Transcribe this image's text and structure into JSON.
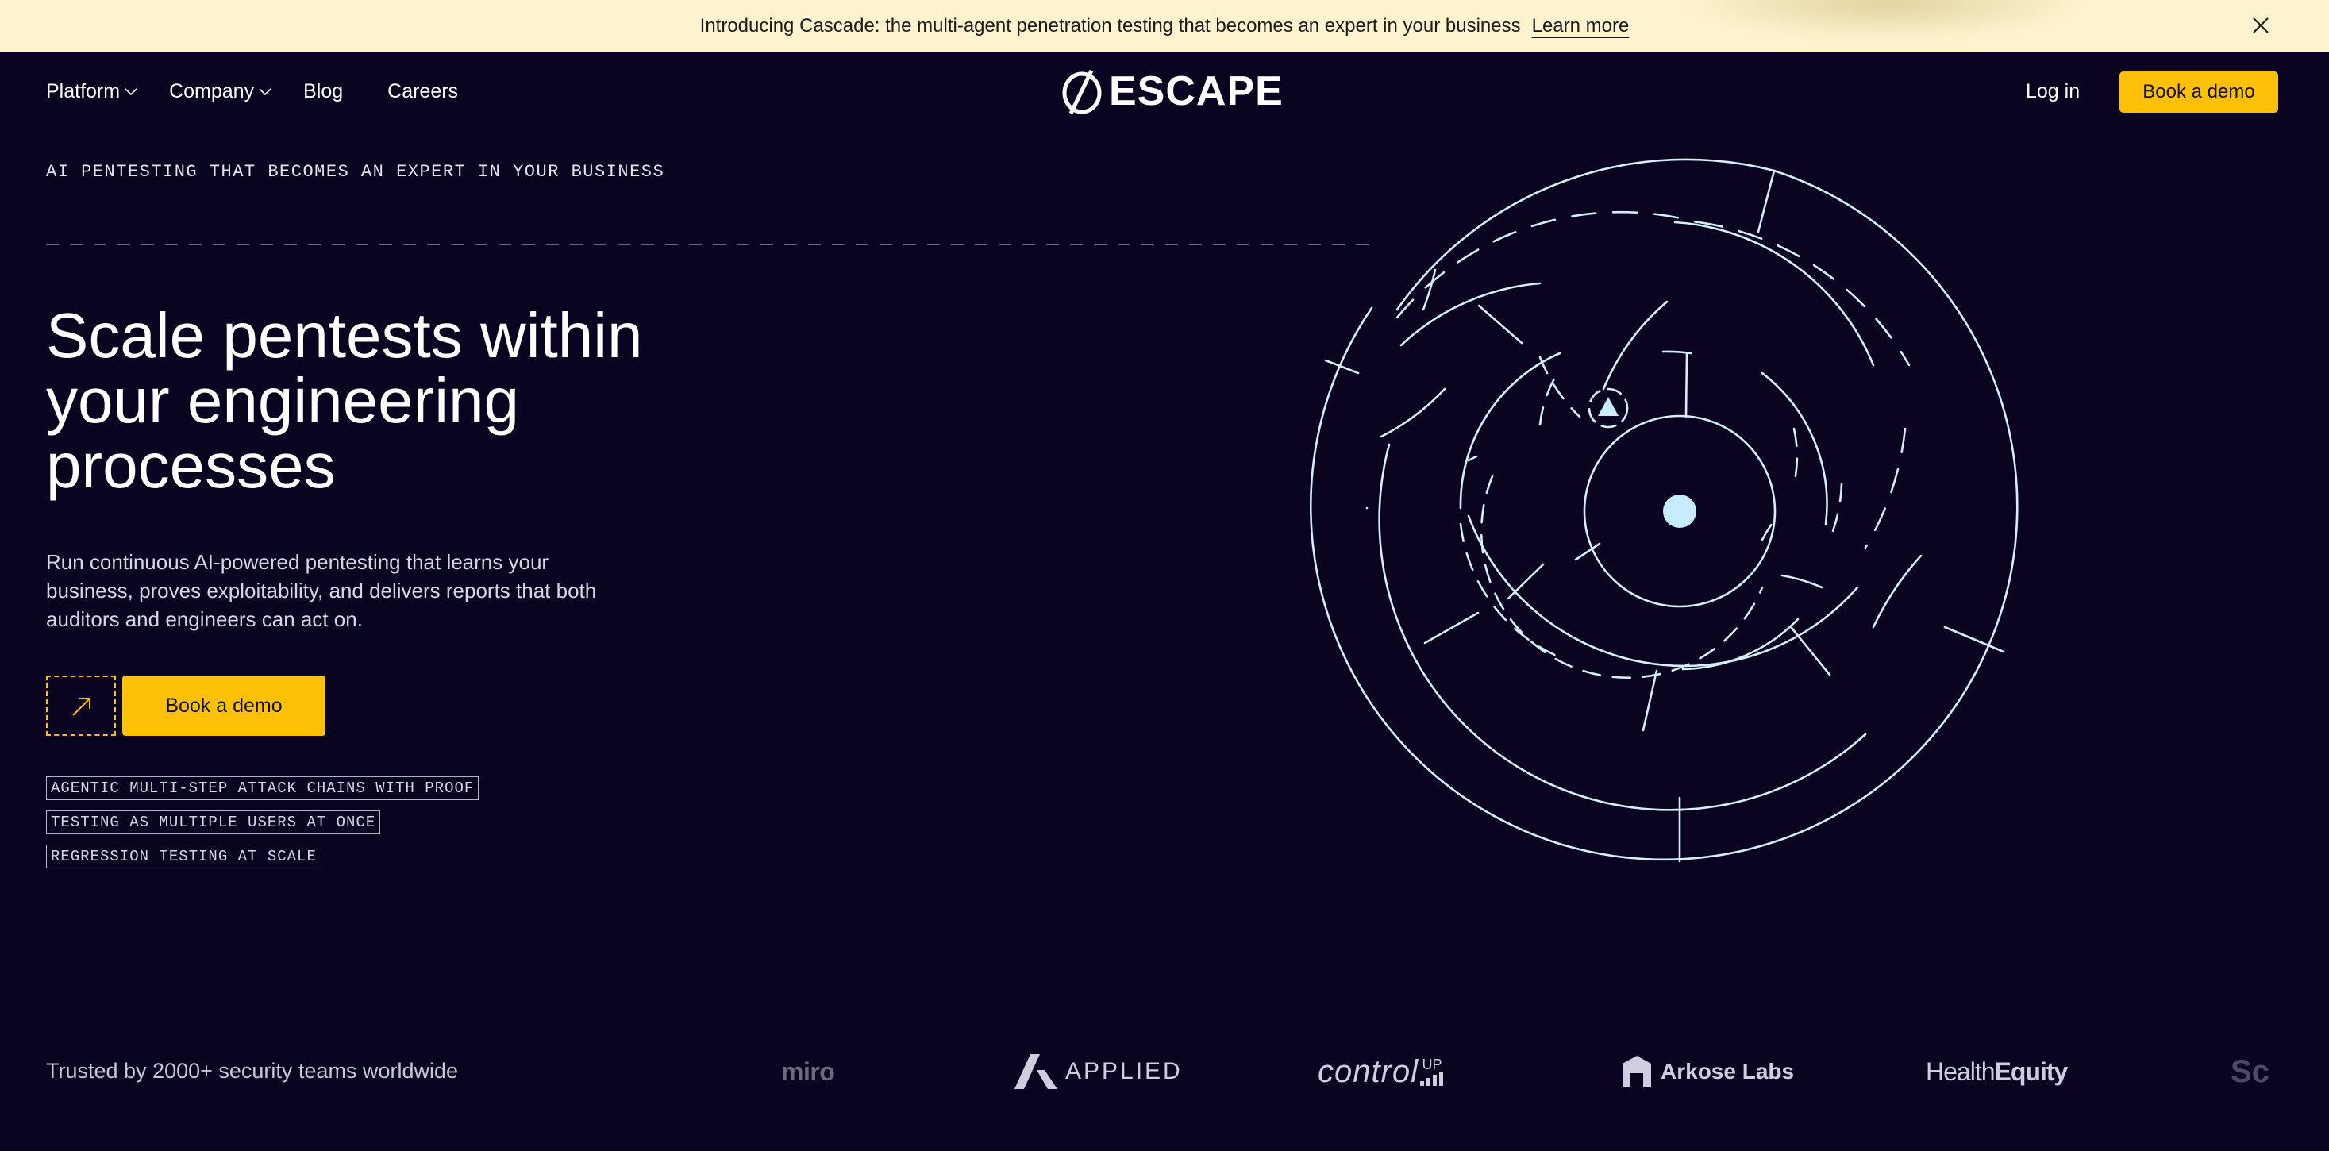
{
  "announcement": {
    "text": "Introducing Cascade: the multi-agent penetration testing that becomes an expert in your business",
    "link_label": "Learn more"
  },
  "nav": {
    "items": [
      {
        "label": "Platform",
        "has_dropdown": true
      },
      {
        "label": "Company",
        "has_dropdown": true
      },
      {
        "label": "Blog",
        "has_dropdown": false
      },
      {
        "label": "Careers",
        "has_dropdown": false
      }
    ],
    "brand": "ESCAPE",
    "login_label": "Log in",
    "demo_label": "Book a demo"
  },
  "hero": {
    "eyebrow": "AI PENTESTING THAT BECOMES AN EXPERT IN YOUR BUSINESS",
    "headline": "Scale pentests within your engineering processes",
    "subtext": "Run continuous AI-powered pentesting that learns your business, proves exploitability, and delivers reports that both auditors and engineers can act on.",
    "cta_label": "Book a demo",
    "tags": [
      "AGENTIC MULTI-STEP ATTACK CHAINS WITH PROOF",
      "TESTING AS MULTIPLE USERS AT ONCE",
      "REGRESSION TESTING AT SCALE"
    ]
  },
  "trusted": {
    "text": "Trusted by 2000+ security teams worldwide",
    "logos": [
      "miro",
      "APPLIED",
      "control",
      "UP",
      "Arkose Labs",
      "Health",
      "Equity",
      "Sc"
    ]
  },
  "colors": {
    "background": "#0a0420",
    "accent": "#ffc107",
    "banner": "#fdf4cf",
    "maze_stroke": "#d6eef8",
    "maze_dot": "#c8ecff"
  },
  "icons": [
    "close-icon",
    "chevron-down-icon",
    "escape-logo-icon",
    "arrow-up-right-icon",
    "maze-illustration"
  ]
}
